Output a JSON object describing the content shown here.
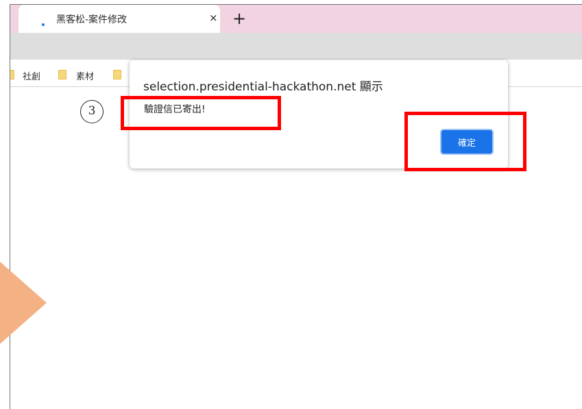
{
  "browser": {
    "tab": {
      "title": "黑客松-案件修改",
      "close_icon": "×",
      "favicon": "loading-dot-icon"
    },
    "new_tab_icon": "+",
    "bookmarks": [
      {
        "label": "社創",
        "icon": "folder-icon"
      },
      {
        "label": "素材",
        "icon": "folder-icon"
      },
      {
        "label": "",
        "icon": "folder-icon"
      }
    ]
  },
  "dialog": {
    "title": "selection.presidential-hackathon.net 顯示",
    "message": "驗證信已寄出!",
    "ok_label": "確定"
  },
  "annotations": {
    "step_number": "3",
    "highlight_color": "#ff0000",
    "arrow_color": "#f4b184"
  },
  "colors": {
    "tabstrip": "#f1d3e2",
    "button": "#1a73e8"
  }
}
